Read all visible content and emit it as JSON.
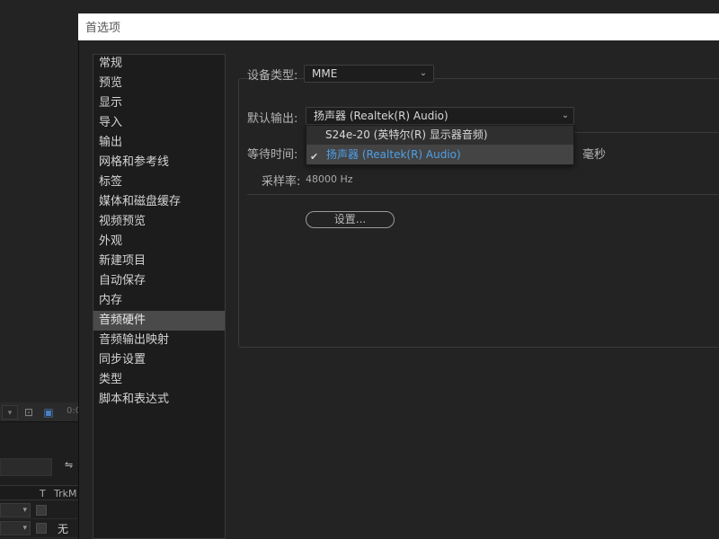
{
  "dialog": {
    "title": "首选项"
  },
  "sidebar": {
    "items": [
      {
        "label": "常规"
      },
      {
        "label": "预览"
      },
      {
        "label": "显示"
      },
      {
        "label": "导入"
      },
      {
        "label": "输出"
      },
      {
        "label": "网格和参考线"
      },
      {
        "label": "标签"
      },
      {
        "label": "媒体和磁盘缓存"
      },
      {
        "label": "视频预览"
      },
      {
        "label": "外观"
      },
      {
        "label": "新建项目"
      },
      {
        "label": "自动保存"
      },
      {
        "label": "内存"
      },
      {
        "label": "音频硬件"
      },
      {
        "label": "音频输出映射"
      },
      {
        "label": "同步设置"
      },
      {
        "label": "类型"
      },
      {
        "label": "脚本和表达式"
      }
    ],
    "selected_index": 13
  },
  "audio_hardware": {
    "device_type_label": "设备类型:",
    "device_type_value": "MME",
    "default_output_label": "默认输出:",
    "default_output_value": "扬声器 (Realtek(R) Audio)",
    "latency_label": "等待时间:",
    "latency_unit": "毫秒",
    "sample_rate_label": "采样率:",
    "sample_rate_value": "48000 Hz",
    "settings_button": "设置..."
  },
  "output_dropdown": {
    "options": [
      {
        "label": "S24e-20 (英特尔(R) 显示器音频)",
        "selected": false
      },
      {
        "label": "扬声器 (Realtek(R) Audio)",
        "selected": true
      }
    ]
  },
  "background_app": {
    "col_t": "T",
    "col_trk": "TrkM",
    "cell_none": "无",
    "time_fragment": "0:0"
  },
  "icons": {
    "chevron": "chevron-down-icon",
    "check": "checkmark-icon"
  }
}
